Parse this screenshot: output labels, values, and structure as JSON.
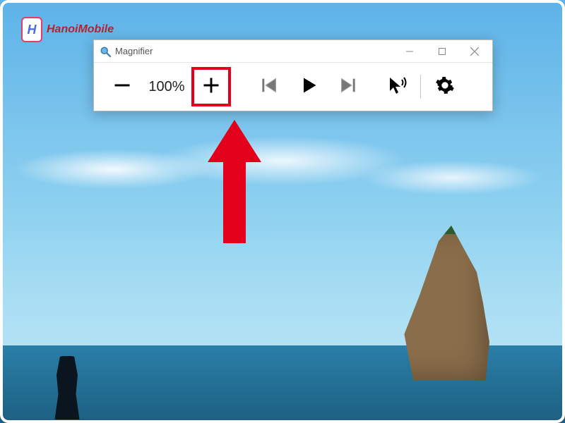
{
  "watermark": {
    "text": "HanoiMobile"
  },
  "window": {
    "title": "Magnifier"
  },
  "toolbar": {
    "zoom_out_label": "Zoom out",
    "zoom_level": "100%",
    "zoom_in_label": "Zoom in",
    "previous_label": "Previous sentence",
    "play_label": "Play",
    "next_label": "Next sentence",
    "read_aloud_label": "Read from here",
    "settings_label": "Settings"
  },
  "annotation": {
    "arrow_points_to": "zoom-in-button"
  }
}
